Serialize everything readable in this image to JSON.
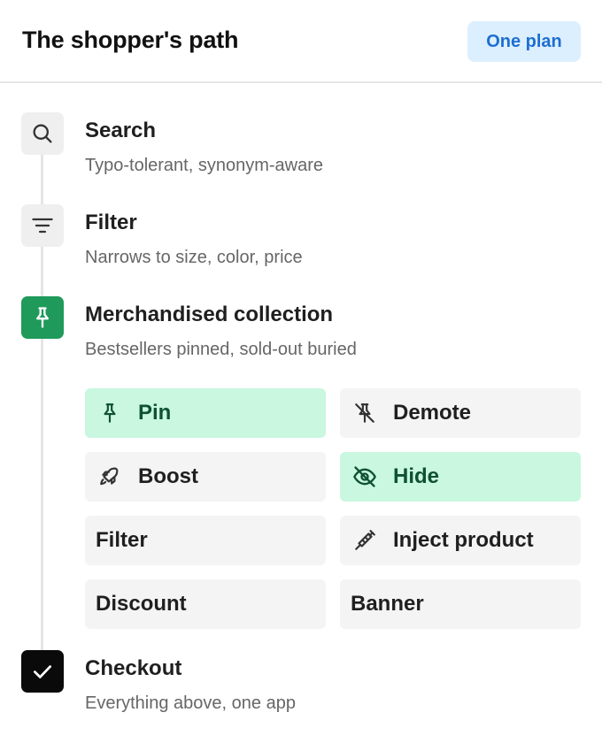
{
  "header": {
    "title": "The shopper's path",
    "badge": "One plan"
  },
  "steps": [
    {
      "icon": "search-icon",
      "title": "Search",
      "subtitle": "Typo-tolerant, synonym-aware"
    },
    {
      "icon": "filter-icon",
      "title": "Filter",
      "subtitle": "Narrows to size, color, price"
    },
    {
      "icon": "pin-icon",
      "title": "Merchandised collection",
      "subtitle": "Bestsellers pinned, sold-out buried"
    },
    {
      "icon": "check-icon",
      "title": "Checkout",
      "subtitle": "Everything above, one app"
    }
  ],
  "actions": [
    {
      "label": "Pin",
      "icon": "pin-icon",
      "active": true
    },
    {
      "label": "Demote",
      "icon": "pin-off-icon",
      "active": false
    },
    {
      "label": "Boost",
      "icon": "rocket-icon",
      "active": false
    },
    {
      "label": "Hide",
      "icon": "eye-off-icon",
      "active": true
    },
    {
      "label": "Filter",
      "icon": "",
      "active": false
    },
    {
      "label": "Inject product",
      "icon": "syringe-icon",
      "active": false
    },
    {
      "label": "Discount",
      "icon": "",
      "active": false
    },
    {
      "label": "Banner",
      "icon": "",
      "active": false
    }
  ],
  "colors": {
    "accent_blue": "#1d6fd1",
    "badge_bg": "#dcefff",
    "active_bg": "#c9f7e0",
    "active_text": "#0f5132",
    "pin_step_green": "#1f9a5a"
  }
}
